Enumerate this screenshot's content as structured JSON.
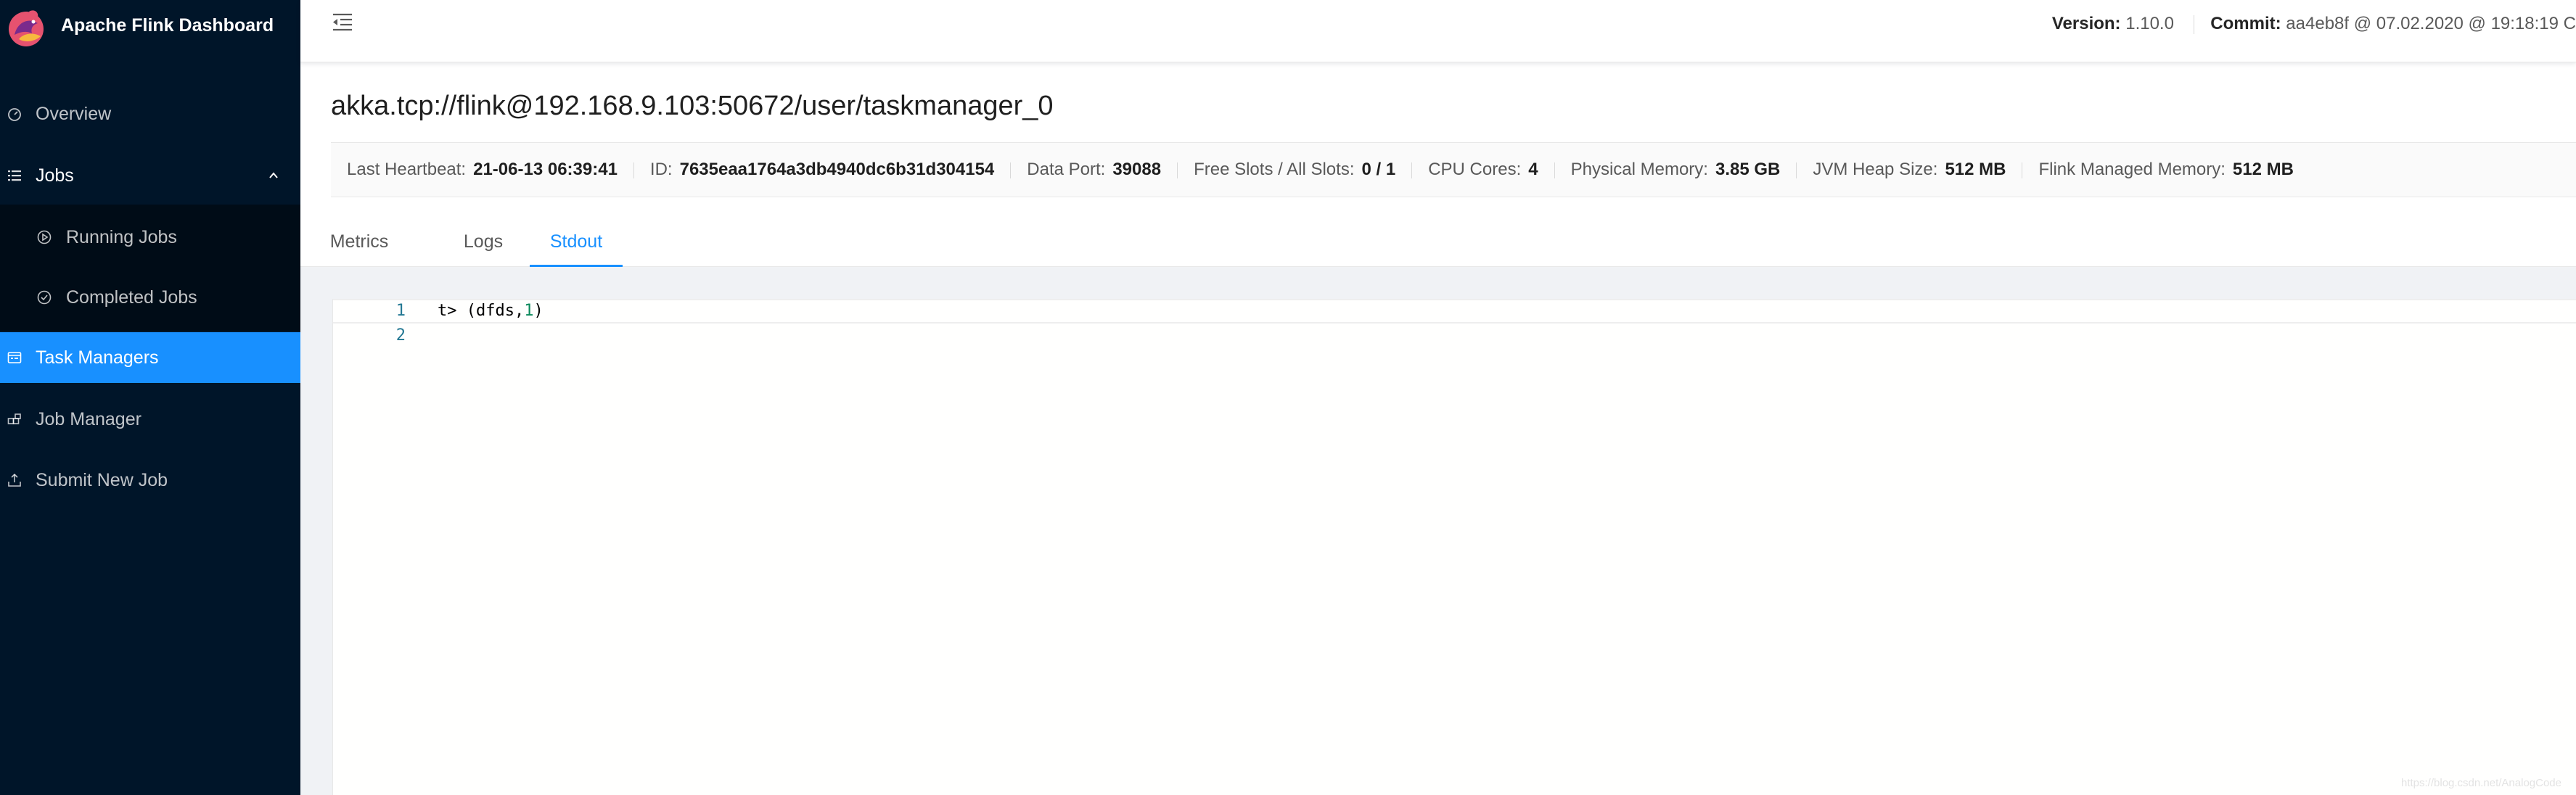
{
  "app": {
    "title": "Apache Flink Dashboard",
    "accent_color": "#1890ff",
    "sidebar_color": "#001529"
  },
  "sidebar": {
    "items": [
      {
        "label": "Overview",
        "icon": "dashboard-icon",
        "active": false
      },
      {
        "label": "Jobs",
        "icon": "list-icon",
        "active": false,
        "expanded": true
      },
      {
        "label": "Running Jobs",
        "icon": "play-circle-icon",
        "active": false,
        "submenu": true
      },
      {
        "label": "Completed Jobs",
        "icon": "check-circle-icon",
        "active": false,
        "submenu": true
      },
      {
        "label": "Task Managers",
        "icon": "schedule-icon",
        "active": true
      },
      {
        "label": "Job Manager",
        "icon": "build-icon",
        "active": false
      },
      {
        "label": "Submit New Job",
        "icon": "upload-icon",
        "active": false
      }
    ]
  },
  "header": {
    "toggle_icon": "menu-fold-icon",
    "version_label": "Version:",
    "version_value": "1.10.0",
    "commit_label": "Commit:",
    "commit_value": "aa4eb8f @ 07.02.2020 @ 19:18:19 C"
  },
  "taskmanager": {
    "title": "akka.tcp://flink@192.168.9.103:50672/user/taskmanager_0",
    "fields": [
      {
        "label": "Last Heartbeat:",
        "value": "21-06-13 06:39:41"
      },
      {
        "label": "ID:",
        "value": "7635eaa1764a3db4940dc6b31d304154"
      },
      {
        "label": "Data Port:",
        "value": "39088"
      },
      {
        "label": "Free Slots / All Slots:",
        "value": "0 / 1"
      },
      {
        "label": "CPU Cores:",
        "value": "4"
      },
      {
        "label": "Physical Memory:",
        "value": "3.85 GB"
      },
      {
        "label": "JVM Heap Size:",
        "value": "512 MB"
      },
      {
        "label": "Flink Managed Memory:",
        "value": "512 MB"
      }
    ]
  },
  "tabs": [
    {
      "label": "Metrics",
      "active": false
    },
    {
      "label": "Logs",
      "active": false
    },
    {
      "label": "Stdout",
      "active": true
    }
  ],
  "stdout": {
    "lines": [
      {
        "number": "1",
        "prefix": "t> (dfds,",
        "num": "1",
        "suffix": ")"
      },
      {
        "number": "2",
        "prefix": "",
        "num": "",
        "suffix": ""
      }
    ]
  },
  "watermark": "https://blog.csdn.net/AnalogCode"
}
